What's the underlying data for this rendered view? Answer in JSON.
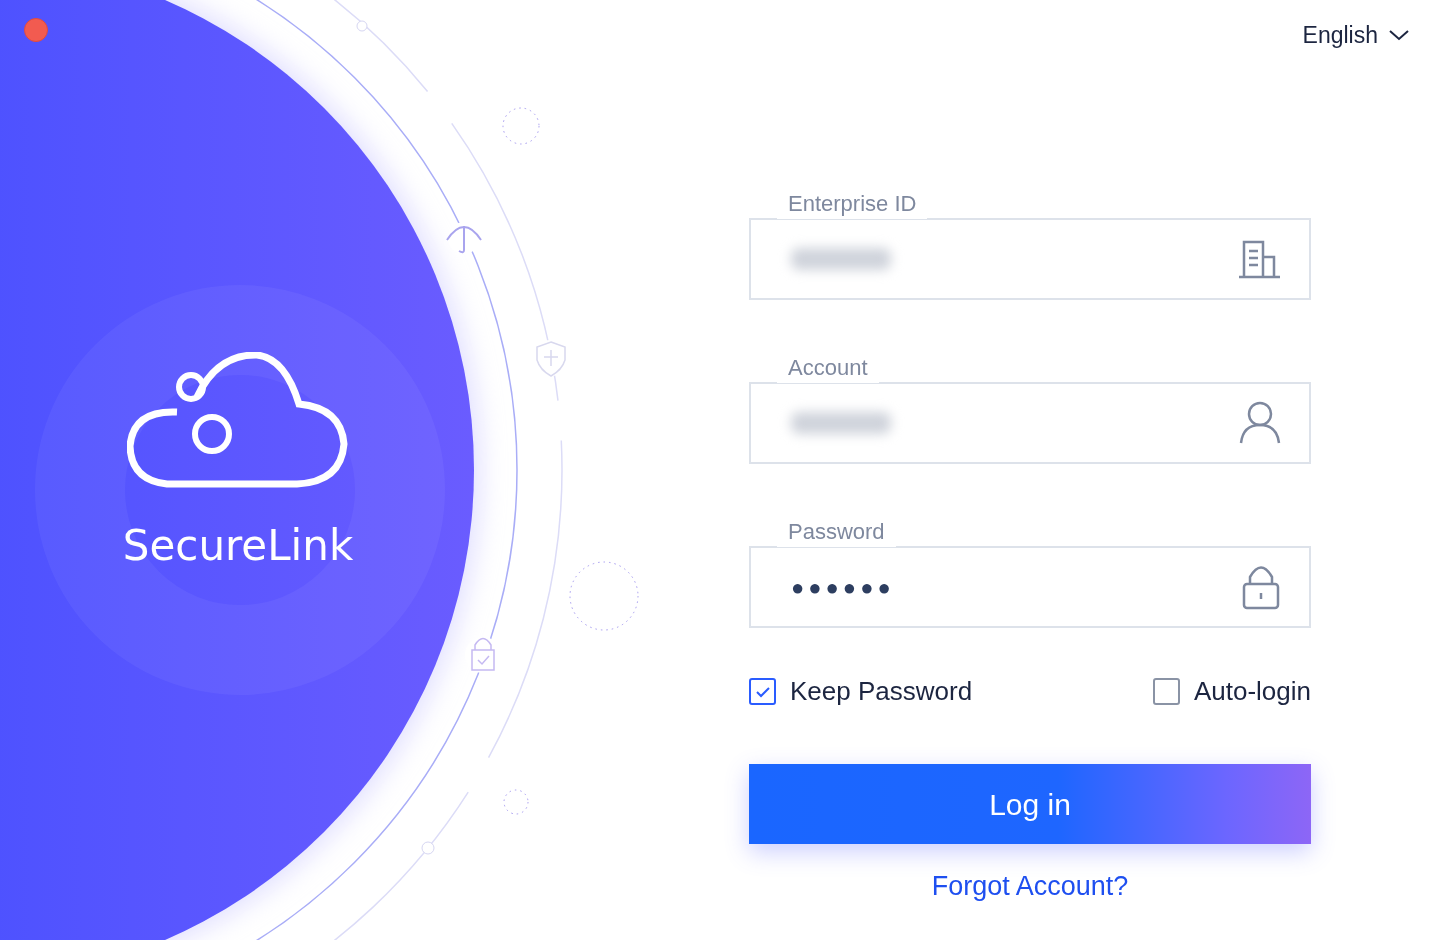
{
  "brand": {
    "name": "SecureLink"
  },
  "language": {
    "label": "English"
  },
  "fields": [
    {
      "kind": "enterprise",
      "label": "Enterprise ID",
      "blurred": true
    },
    {
      "kind": "account",
      "label": "Account",
      "blurred": true
    },
    {
      "kind": "password",
      "label": "Password",
      "value": "●●●●●●"
    }
  ],
  "options": [
    {
      "label": "Keep Password",
      "checked": true
    },
    {
      "label": "Auto-login",
      "checked": false
    }
  ],
  "login_button": "Log in",
  "forgot_link": "Forgot Account?"
}
